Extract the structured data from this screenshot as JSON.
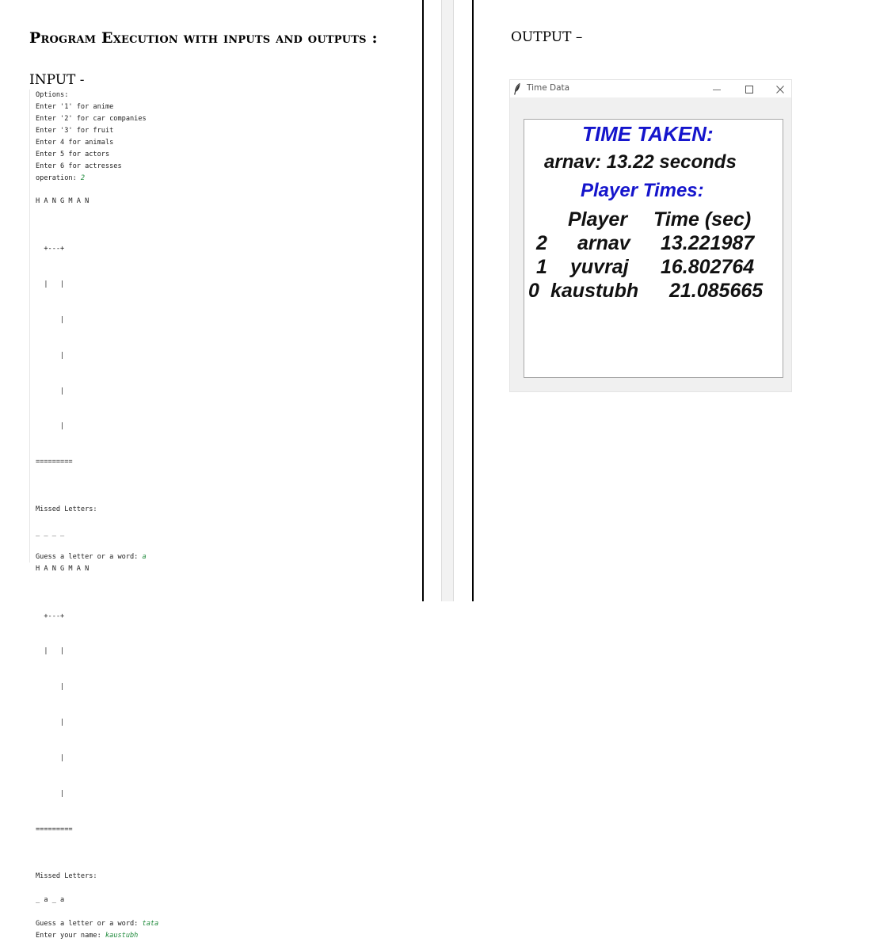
{
  "document": {
    "heading": "Program Execution with inputs and outputs :",
    "input_label": "INPUT -",
    "output_label": "OUTPUT –"
  },
  "console": {
    "menu_lines": [
      "Options:",
      "Enter '1' for anime",
      "Enter '2' for car companies",
      "Enter '3' for fruit",
      "Enter 4 for animals",
      "Enter 5 for actors",
      "Enter 6 for actresses"
    ],
    "operation_prompt": "operation: ",
    "operation_value": "2",
    "hangman_title": "H A N G M A N",
    "gallows_top": "  +---+",
    "gallows_neck": "  |   |",
    "gallows_post": "      |",
    "gallows_base": "=========",
    "missed_letters_label": "Missed Letters:",
    "blanks_1": "_ _ _ _",
    "guess_prompt": "Guess a letter or a word: ",
    "guess_1": "a",
    "blanks_2": "_ a _ a",
    "guess_2": "tata",
    "name_prompt": "Enter your name: ",
    "name_value": "kaustubh"
  },
  "window": {
    "title": "Time Data",
    "minimize_icon": "minimize-icon",
    "maximize_icon": "maximize-icon",
    "close_icon": "close-icon",
    "colors": {
      "heading": "#1515cc",
      "text": "#111111"
    },
    "time_taken_heading": "TIME TAKEN:",
    "current_result": "arnav: 13.22 seconds",
    "player_times_heading": "Player Times:",
    "table": {
      "headers": [
        "Player",
        "Time (sec)"
      ],
      "rows": [
        {
          "index": "2",
          "player": "arnav",
          "time": "13.221987"
        },
        {
          "index": "1",
          "player": "yuvraj",
          "time": "16.802764"
        },
        {
          "index": "0",
          "player": "kaustubh",
          "time": "21.085665"
        }
      ]
    }
  }
}
